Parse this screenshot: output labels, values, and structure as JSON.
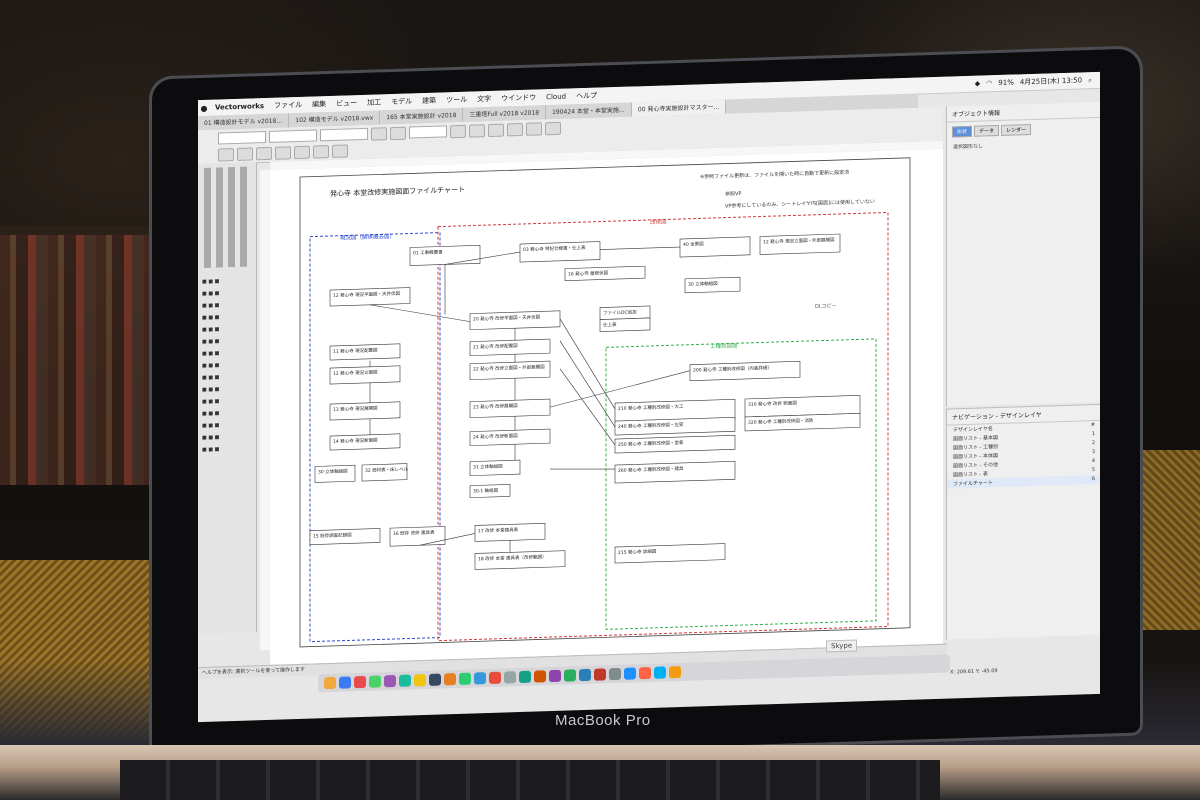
{
  "menubar": {
    "app": "Vectorworks",
    "menus": [
      "ファイル",
      "編集",
      "ビュー",
      "加工",
      "モデル",
      "建築",
      "ツール",
      "文字",
      "ウインドウ",
      "Cloud",
      "ヘルプ"
    ],
    "battery": "91%",
    "datetime": "4月25日(木) 13:50"
  },
  "tabs": [
    "01 構造設計モデル v2018…",
    "102 構造モデル v2018.vwx",
    "165 本堂実施設計 v2018",
    "三重塔Full v2018 v2018",
    "190424 本堂・本堂実施…",
    "00 発心寺実施設計マスター…"
  ],
  "object_info": {
    "title": "オブジェクト情報",
    "tabs": [
      "形状",
      "データ",
      "レンダー"
    ],
    "empty": "選択図形なし"
  },
  "navigation": {
    "title": "ナビゲーション - デザインレイヤ",
    "col_name": "デザインレイヤ名",
    "col_num": "#",
    "rows": [
      {
        "name": "図面リスト - 基本図",
        "num": "1"
      },
      {
        "name": "図面リスト - 工種別",
        "num": "2"
      },
      {
        "name": "図面リスト - 本体図",
        "num": "3"
      },
      {
        "name": "図面リスト - その他",
        "num": "4"
      },
      {
        "name": "図面リスト - 表",
        "num": "5"
      },
      {
        "name": "ファイルチャート",
        "num": "6"
      }
    ]
  },
  "chart": {
    "title": "発心寺 本堂改修実施図面ファイルチャート",
    "legend_lines": [
      "※参照ファイル更新は、ファイルを開いた時に自動で更新に設定済",
      "参照VP",
      "VP参考にしているのみ、シートレイヤ内[図面]には使用していない"
    ],
    "group_left": "現況図（解体撤去図）",
    "group_right": "改修図",
    "group_sub": "工種別図面",
    "boxes": [
      "01 工事概要書",
      "03 発心寺 特記仕様書・仕上表",
      "12 発心寺 現況平面図・天井伏図",
      "20 発心寺 改修平面図・天井伏図",
      "11 発心寺 現況配置図",
      "21 発心寺 改修配置図",
      "12 発心寺 現況立面図",
      "22 発心寺 改修立面図・外部展開図",
      "13 発心寺 現況展開図",
      "23 発心寺 改修展開図",
      "14 発心寺 現況断面図",
      "24 発心寺 改修断面図",
      "30 立体軸組図",
      "32 部材表・床レベル",
      "31 立体軸組図",
      "30-1 軸組図",
      "15 既存調査記録図",
      "16 既存 改修 建具表",
      "17 改修 本堂建具表",
      "18 改修 本堂 建具表（改修範囲）",
      "200 発心寺 工種別改修図（内装詳細）",
      "210 発心寺 工種別改修図・大工",
      "240 発心寺 工種別改修図・左官",
      "250 発心寺 工種別改修図・塗装",
      "260 発心寺 工種別改修図・建具",
      "310 発心寺 改修 断面図",
      "320 発心寺 工種別改修図・消防",
      "215 発心寺 詳細図",
      "40 全景図",
      "12 発心寺 現況立面図・外部展開図",
      "30 立体軸組図",
      "16 発心寺 屋根伏図",
      "ファイルDC追加",
      "仕上表"
    ],
    "note_dl": "DLコピー"
  },
  "statusbar": {
    "hint": "ヘルプを表示: 選択ツールを使って操作します",
    "coords": "X: 209.61    Y: -45.09"
  },
  "dock": {
    "skype": "Skype"
  },
  "laptop": {
    "brand": "MacBook Pro"
  },
  "colors": {
    "accent": "#5f8fd6",
    "group_blue": "#2c4bd1",
    "group_red": "#d43b3b",
    "group_green": "#31b04a"
  }
}
